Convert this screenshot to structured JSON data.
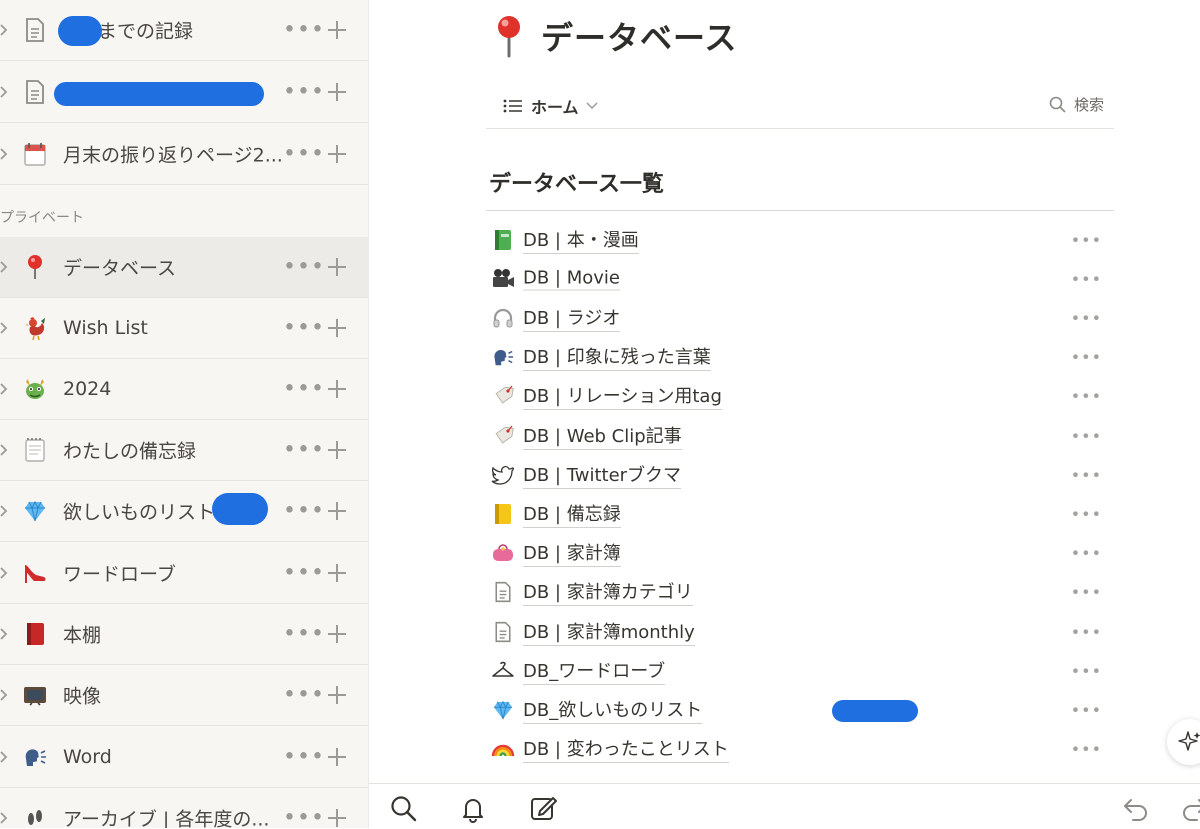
{
  "sidebar": {
    "section_private": "プライベート",
    "items": [
      {
        "label": "までの記録",
        "icon": "document-icon"
      },
      {
        "label": "",
        "icon": "document-icon"
      },
      {
        "label": "月末の振り返りページ2...",
        "icon": "calendar-icon"
      },
      {
        "label": "データベース",
        "icon": "pin-icon",
        "active": true
      },
      {
        "label": "Wish List",
        "icon": "rooster-icon"
      },
      {
        "label": "2024",
        "icon": "dragon-icon"
      },
      {
        "label": "わたしの備忘録",
        "icon": "notepad-icon"
      },
      {
        "label": "欲しいものリスト",
        "icon": "gem-icon"
      },
      {
        "label": "ワードローブ",
        "icon": "high-heel-icon"
      },
      {
        "label": "本棚",
        "icon": "red-book-icon"
      },
      {
        "label": "映像",
        "icon": "tv-icon"
      },
      {
        "label": "Word",
        "icon": "speaking-head-icon"
      },
      {
        "label": "アーカイブ | 各年度の...",
        "icon": "footprints-icon"
      }
    ]
  },
  "page": {
    "title": "データベース",
    "icon": "pin-icon",
    "view_tab": "ホーム",
    "search_label": "検索",
    "list_header": "データベース一覧",
    "databases": [
      {
        "label": "DB | 本・漫画",
        "icon": "green-book-icon"
      },
      {
        "label": "DB | Movie",
        "icon": "movie-camera-icon"
      },
      {
        "label": "DB | ラジオ",
        "icon": "headphones-icon"
      },
      {
        "label": "DB | 印象に残った言葉",
        "icon": "speaking-head-icon"
      },
      {
        "label": "DB | リレーション用tag",
        "icon": "tag-icon"
      },
      {
        "label": "DB | Web Clip記事",
        "icon": "tag-icon"
      },
      {
        "label": "DB | Twitterブクマ",
        "icon": "bird-icon"
      },
      {
        "label": "DB | 備忘録",
        "icon": "yellow-ledger-icon"
      },
      {
        "label": "DB | 家計簿",
        "icon": "purse-icon"
      },
      {
        "label": "DB | 家計簿カテゴリ",
        "icon": "document-icon"
      },
      {
        "label": "DB | 家計簿monthly",
        "icon": "document-icon"
      },
      {
        "label": "DB_ワードローブ",
        "icon": "hanger-icon"
      },
      {
        "label": "DB_欲しいものリスト",
        "icon": "gem-icon"
      },
      {
        "label": "DB | 変わったことリスト",
        "icon": "rainbow-icon"
      }
    ]
  },
  "bottom_bar": {
    "icons": [
      "search-icon",
      "bell-icon",
      "compose-icon",
      "undo-icon",
      "redo-icon"
    ]
  },
  "colors": {
    "sidebar_bg": "#f7f6f3",
    "active_row_bg": "#ecebe8",
    "redaction_blue": "#1f6fe0",
    "text": "#37352f"
  }
}
